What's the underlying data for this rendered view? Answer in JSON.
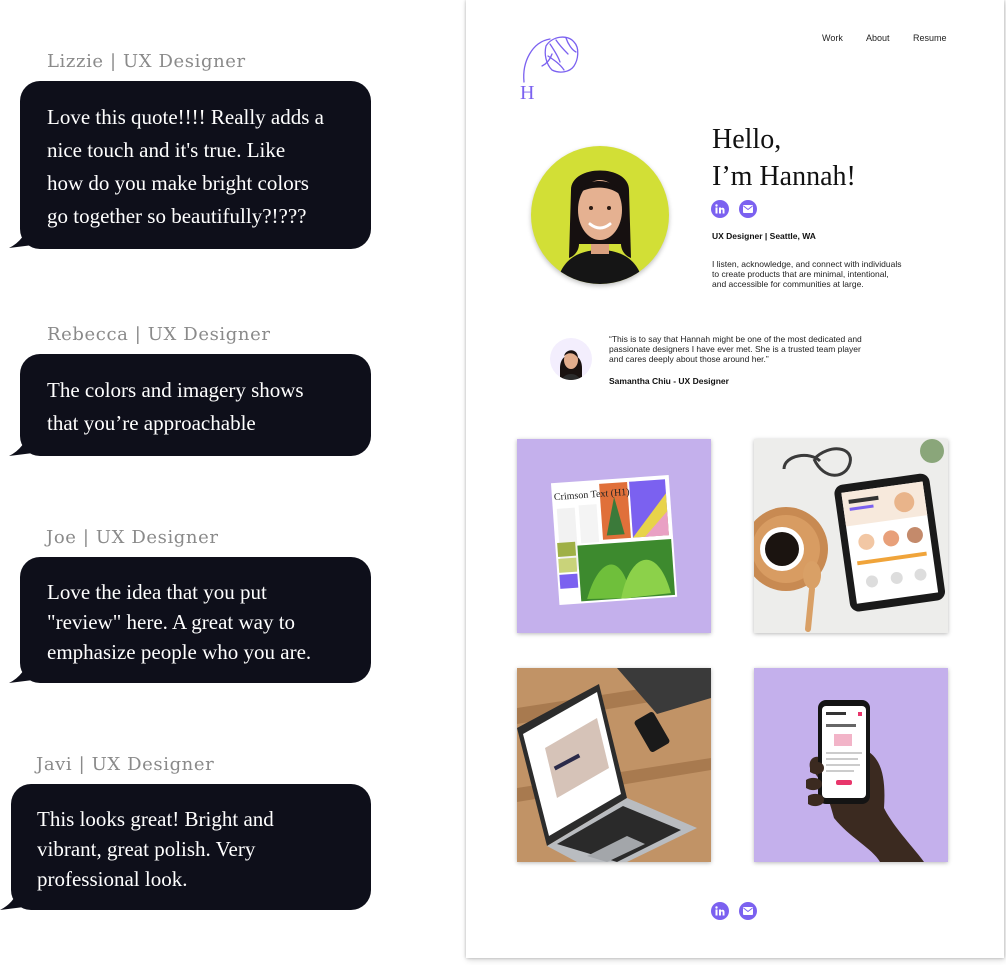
{
  "feedback": [
    {
      "author": "Lizzie | UX Designer",
      "text": "Love this quote!!!! Really adds a\nnice touch and it's true. Like\nhow do you make bright colors\ngo together so beautifully?!???"
    },
    {
      "author": "Rebecca | UX Designer",
      "text": "The colors and imagery shows\nthat you’re approachable"
    },
    {
      "author": "Joe | UX Designer",
      "text": "Love the idea that you put\n\"review\" here. A great way to\nemphasize people who you are."
    },
    {
      "author": "Javi | UX Designer",
      "text": "This looks great! Bright and\nvibrant, great polish. Very\nprofessional look."
    }
  ],
  "portfolio": {
    "logo_letter": "H",
    "nav": [
      "Work",
      "About",
      "Resume"
    ],
    "greeting_line1": "Hello,",
    "greeting_line2": "I’m Hannah!",
    "role": "UX Designer | Seattle, WA",
    "bio": "I listen, acknowledge, and connect with individuals\nto create products that are minimal, intentional,\nand accessible for communities at large.",
    "quote": "“This is to say that Hannah might be one of the most dedicated and\npassionate designers I have ever met. She is a trusted team player\nand cares deeply about those around her.”",
    "quote_author": "Samantha Chiu - UX Designer",
    "style_guide_heading": "Crimson Text (H1)",
    "social_icons": [
      "linkedin-icon",
      "mail-icon"
    ],
    "accent_color": "#7b61f0",
    "card_background": "#c4b0ec",
    "portrait_background": "#d2df36"
  }
}
